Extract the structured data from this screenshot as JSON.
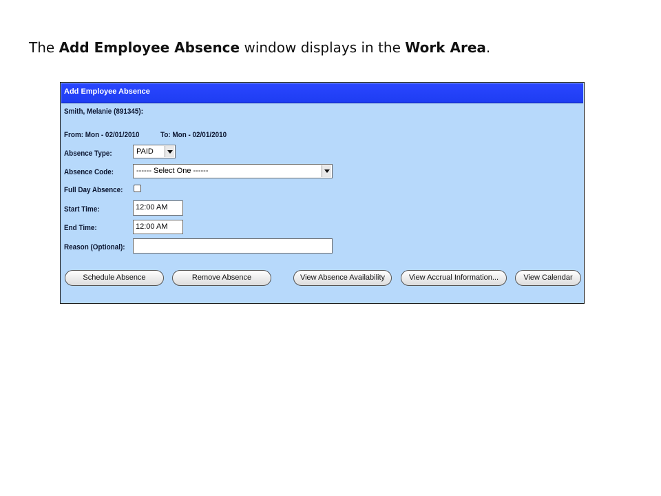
{
  "caption": {
    "prefix": "The ",
    "bold1": "Add Employee Absence",
    "middle": " window displays in the ",
    "bold2": "Work Area",
    "suffix": "."
  },
  "window": {
    "title": "Add Employee Absence",
    "employee": "Smith, Melanie (891345):",
    "from": "From: Mon - 02/01/2010",
    "to": "To: Mon - 02/01/2010"
  },
  "form": {
    "absence_type": {
      "label": "Absence Type:",
      "value": "PAID"
    },
    "absence_code": {
      "label": "Absence Code:",
      "value": "------ Select One ------"
    },
    "full_day": {
      "label": "Full Day Absence:",
      "checked": false
    },
    "start_time": {
      "label": "Start Time:",
      "value": "12:00 AM"
    },
    "end_time": {
      "label": "End Time:",
      "value": "12:00 AM"
    },
    "reason": {
      "label": "Reason (Optional):",
      "value": ""
    }
  },
  "buttons": {
    "schedule": "Schedule Absence",
    "remove": "Remove Absence",
    "availability": "View Absence Availability",
    "accrual": "View Accrual Information...",
    "calendar": "View Calendar"
  }
}
